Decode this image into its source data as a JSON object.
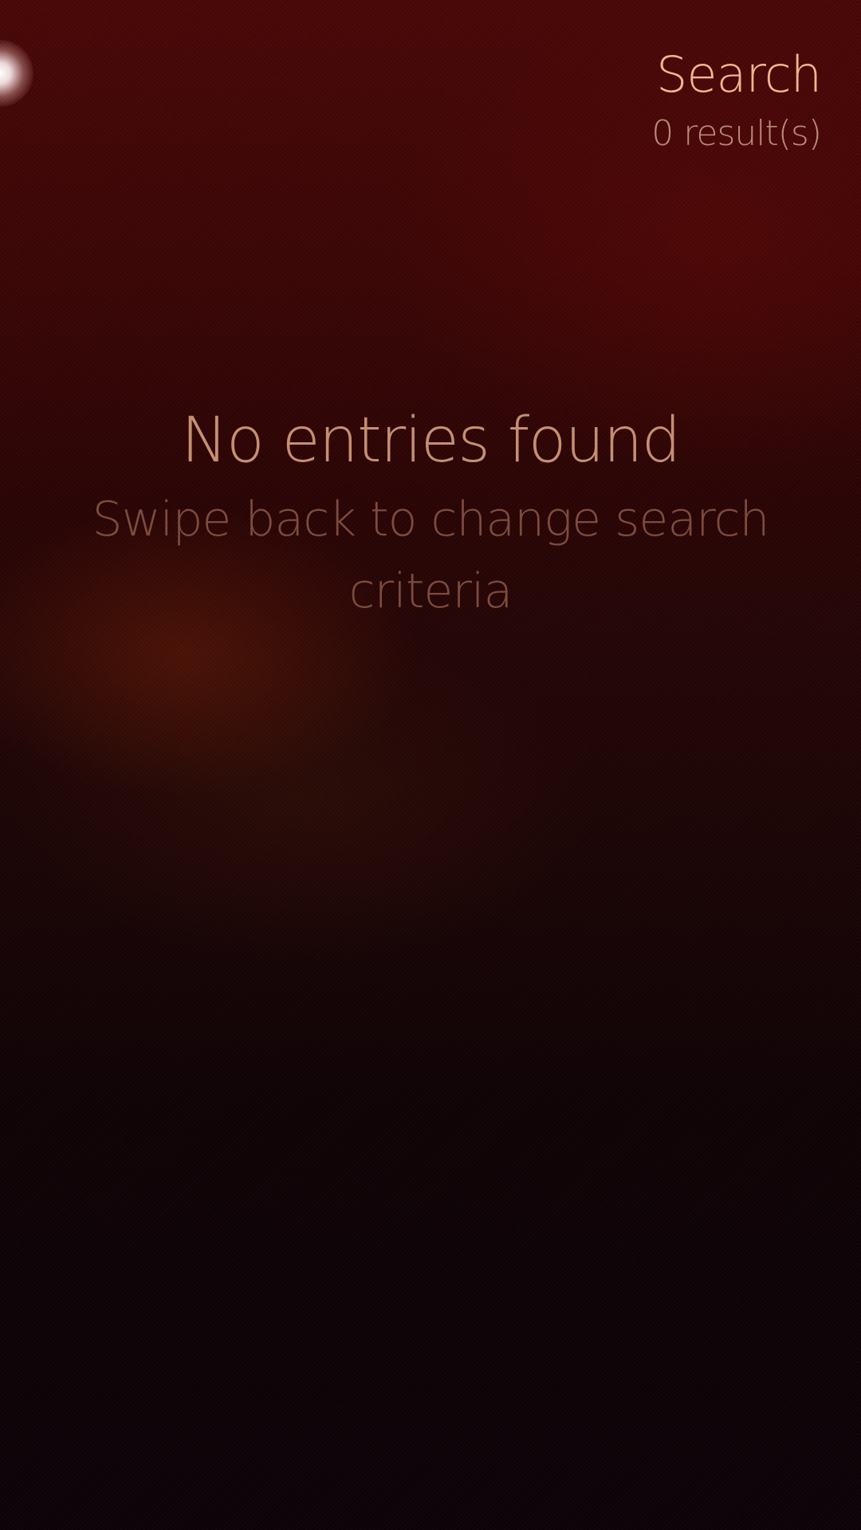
{
  "header": {
    "title": "Search",
    "subtitle": "0 result(s)"
  },
  "placeholder": {
    "text": "No entries found",
    "hint": "Swipe back to change search criteria"
  },
  "colors": {
    "highlight": "#f2b48d",
    "secondary": "#b98a78",
    "placeholder_text": "#c58f72",
    "placeholder_hint": "#7d4c3e",
    "background_top": "#4a0808",
    "background_bottom": "#0c0308"
  }
}
